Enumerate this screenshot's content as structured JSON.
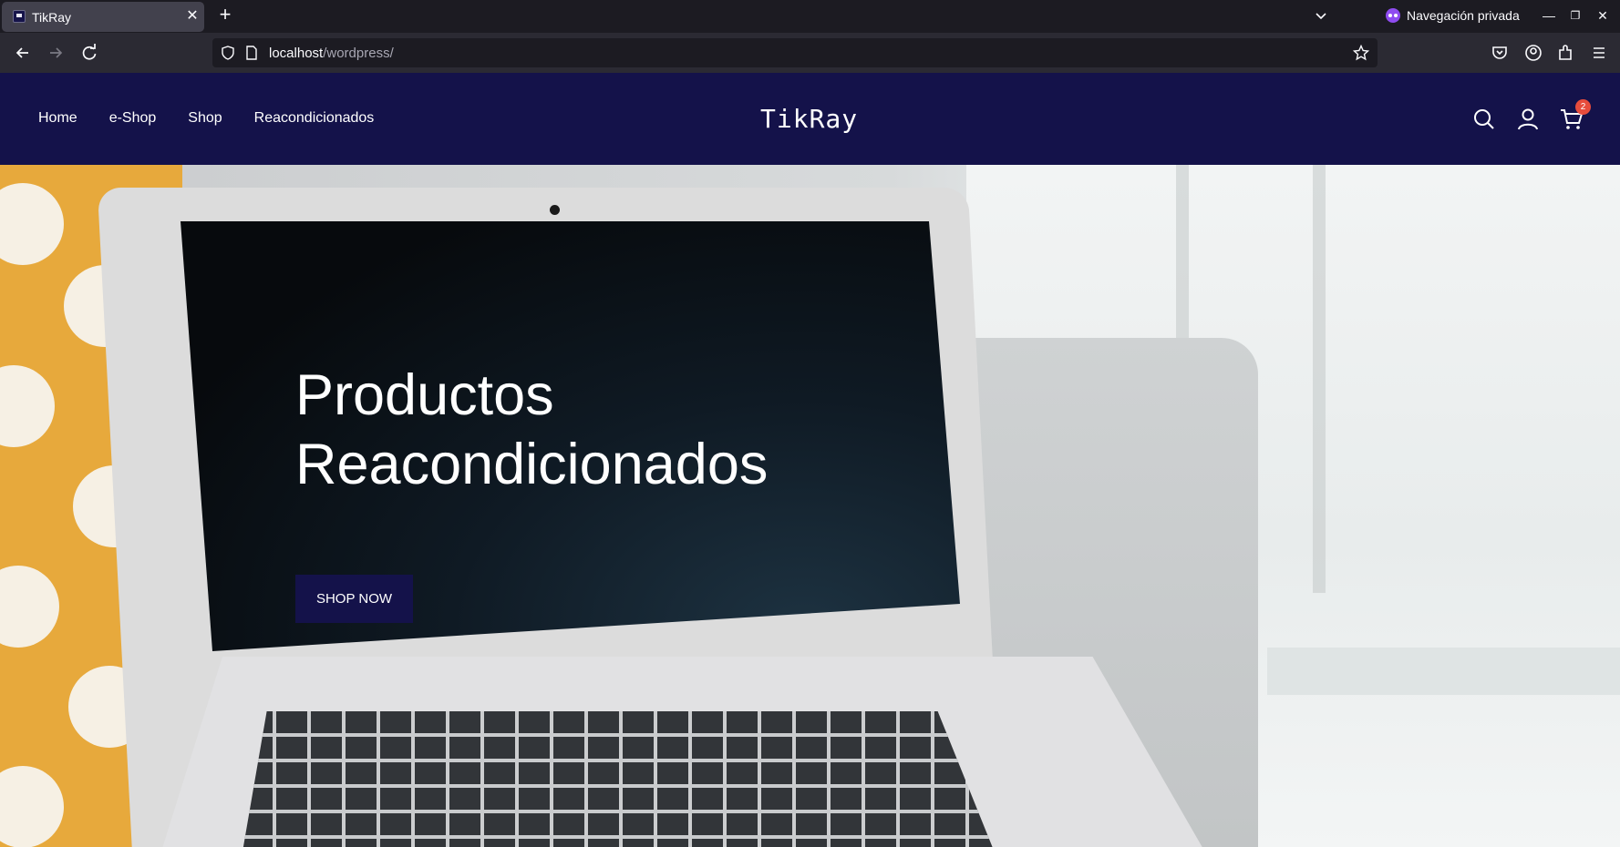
{
  "browser": {
    "tab_title": "TikRay",
    "private_label": "Navegación privada",
    "url_host": "localhost",
    "url_path": "/wordpress/"
  },
  "site": {
    "logo": "TikRay",
    "nav": [
      "Home",
      "e-Shop",
      "Shop",
      "Reacondicionados"
    ],
    "cart_count": "2"
  },
  "hero": {
    "title_line1": "Productos",
    "title_line2": "Reacondicionados",
    "button": "SHOP NOW"
  },
  "colors": {
    "header_bg": "#14124a",
    "badge": "#e74c3c"
  }
}
